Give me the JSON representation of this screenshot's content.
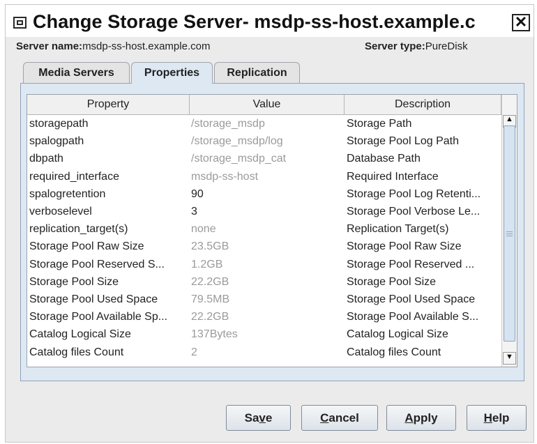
{
  "window": {
    "title": "Change Storage Server- msdp-ss-host.example.c",
    "close_glyph": "✕"
  },
  "info": {
    "server_name_label": "Server name:",
    "server_name_value": "msdp-ss-host.example.com",
    "server_type_label": "Server type:",
    "server_type_value": "PureDisk"
  },
  "tabs": [
    {
      "label": "Media Servers"
    },
    {
      "label": "Properties"
    },
    {
      "label": "Replication"
    }
  ],
  "active_tab": "Properties",
  "table": {
    "headers": [
      "Property",
      "Value",
      "Description"
    ],
    "rows": [
      {
        "property": "storagepath",
        "value": "/storage_msdp",
        "description": "Storage Path",
        "editable": false
      },
      {
        "property": "spalogpath",
        "value": "/storage_msdp/log",
        "description": "Storage Pool Log Path",
        "editable": false
      },
      {
        "property": "dbpath",
        "value": "/storage_msdp_cat",
        "description": "Database Path",
        "editable": false
      },
      {
        "property": "required_interface",
        "value": "msdp-ss-host",
        "description": "Required Interface",
        "editable": false
      },
      {
        "property": "spalogretention",
        "value": "90",
        "description": "Storage Pool Log Retenti...",
        "editable": true
      },
      {
        "property": "verboselevel",
        "value": "3",
        "description": "Storage Pool Verbose Le...",
        "editable": true
      },
      {
        "property": "replication_target(s)",
        "value": "none",
        "description": "Replication Target(s)",
        "editable": false
      },
      {
        "property": "Storage Pool Raw Size",
        "value": "23.5GB",
        "description": "Storage Pool Raw Size",
        "editable": false
      },
      {
        "property": "Storage Pool Reserved S...",
        "value": "1.2GB",
        "description": "Storage Pool Reserved ...",
        "editable": false
      },
      {
        "property": "Storage Pool Size",
        "value": "22.2GB",
        "description": "Storage Pool Size",
        "editable": false
      },
      {
        "property": "Storage Pool Used Space",
        "value": "79.5MB",
        "description": "Storage Pool Used Space",
        "editable": false
      },
      {
        "property": "Storage Pool Available Sp...",
        "value": "22.2GB",
        "description": "Storage Pool Available S...",
        "editable": false
      },
      {
        "property": "Catalog Logical Size",
        "value": "137Bytes",
        "description": "Catalog Logical Size",
        "editable": false
      },
      {
        "property": "Catalog files Count",
        "value": "2",
        "description": "Catalog files Count",
        "editable": false
      }
    ]
  },
  "scroll": {
    "up_glyph": "▲",
    "down_glyph": "▼"
  },
  "buttons": {
    "save": {
      "pre": "Sa",
      "mnemonic": "v",
      "post": "e"
    },
    "cancel": {
      "pre": "",
      "mnemonic": "C",
      "post": "ancel"
    },
    "apply": {
      "pre": "",
      "mnemonic": "A",
      "post": "pply"
    },
    "help": {
      "pre": "",
      "mnemonic": "H",
      "post": "elp"
    }
  },
  "colors": {
    "panel_bg": "#dde8f3",
    "window_bg": "#ebebeb",
    "readonly_value": "#9a9a9a",
    "editable_value": "#222222"
  }
}
